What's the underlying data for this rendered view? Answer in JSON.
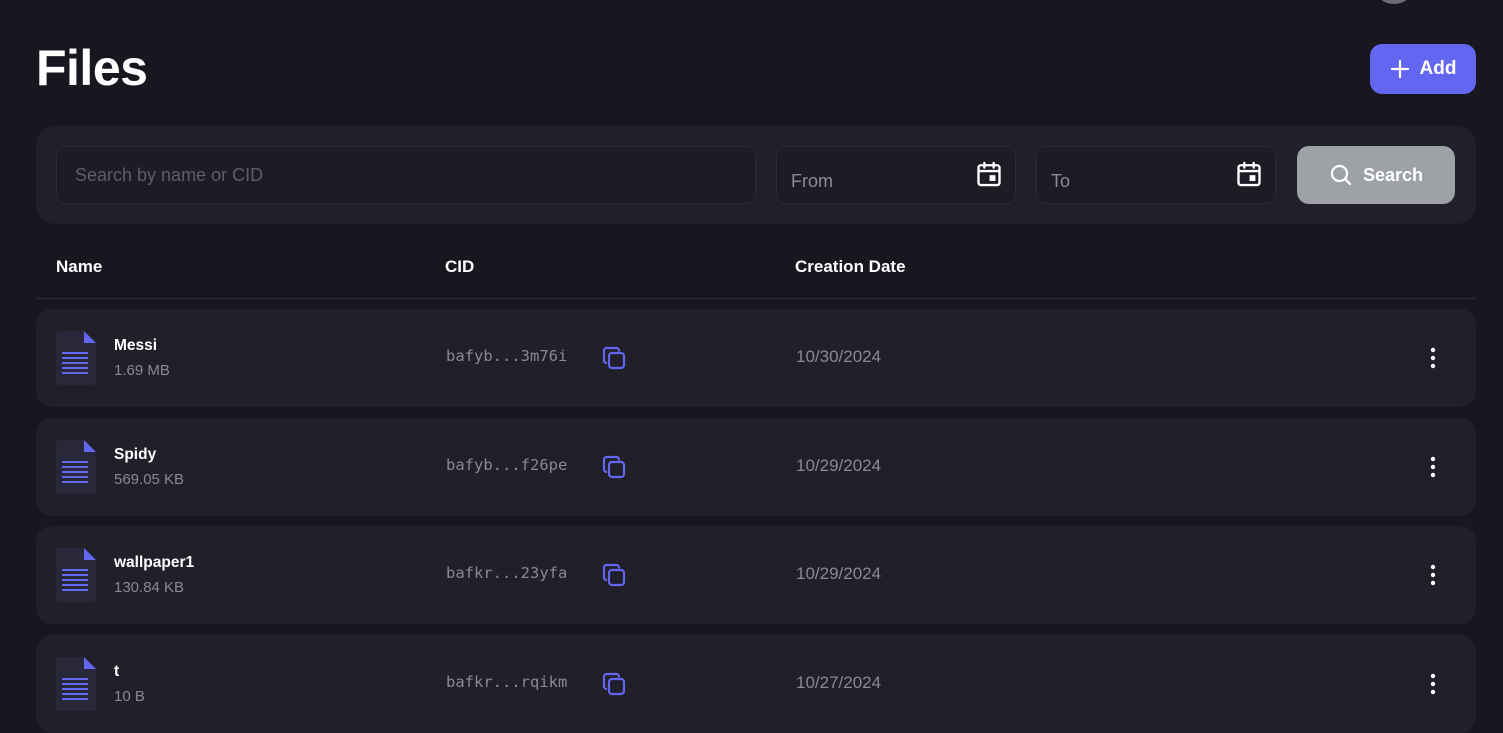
{
  "page": {
    "title": "Files"
  },
  "toolbar": {
    "add_label": "Add"
  },
  "filters": {
    "search_placeholder": "Search by name or CID",
    "search_value": "",
    "from_label": "From",
    "to_label": "To",
    "search_button_label": "Search"
  },
  "table": {
    "headers": {
      "name": "Name",
      "cid": "CID",
      "date": "Creation Date"
    },
    "rows": [
      {
        "name": "Messi",
        "size": "1.69 MB",
        "cid": "bafyb...3m76i",
        "date": "10/30/2024"
      },
      {
        "name": "Spidy",
        "size": "569.05 KB",
        "cid": "bafyb...f26pe",
        "date": "10/29/2024"
      },
      {
        "name": "wallpaper1",
        "size": "130.84 KB",
        "cid": "bafkr...23yfa",
        "date": "10/29/2024"
      },
      {
        "name": "t",
        "size": "10 B",
        "cid": "bafkr...rqikm",
        "date": "10/27/2024"
      }
    ]
  },
  "icons": {
    "add": "plus-icon",
    "calendar": "calendar-icon",
    "search": "search-icon",
    "file": "document-icon",
    "copy": "copy-icon",
    "more": "more-vertical-icon"
  },
  "colors": {
    "background": "#18161f",
    "panel": "#211f29",
    "accent": "#6366f1",
    "search_button": "#9ea1a6"
  }
}
